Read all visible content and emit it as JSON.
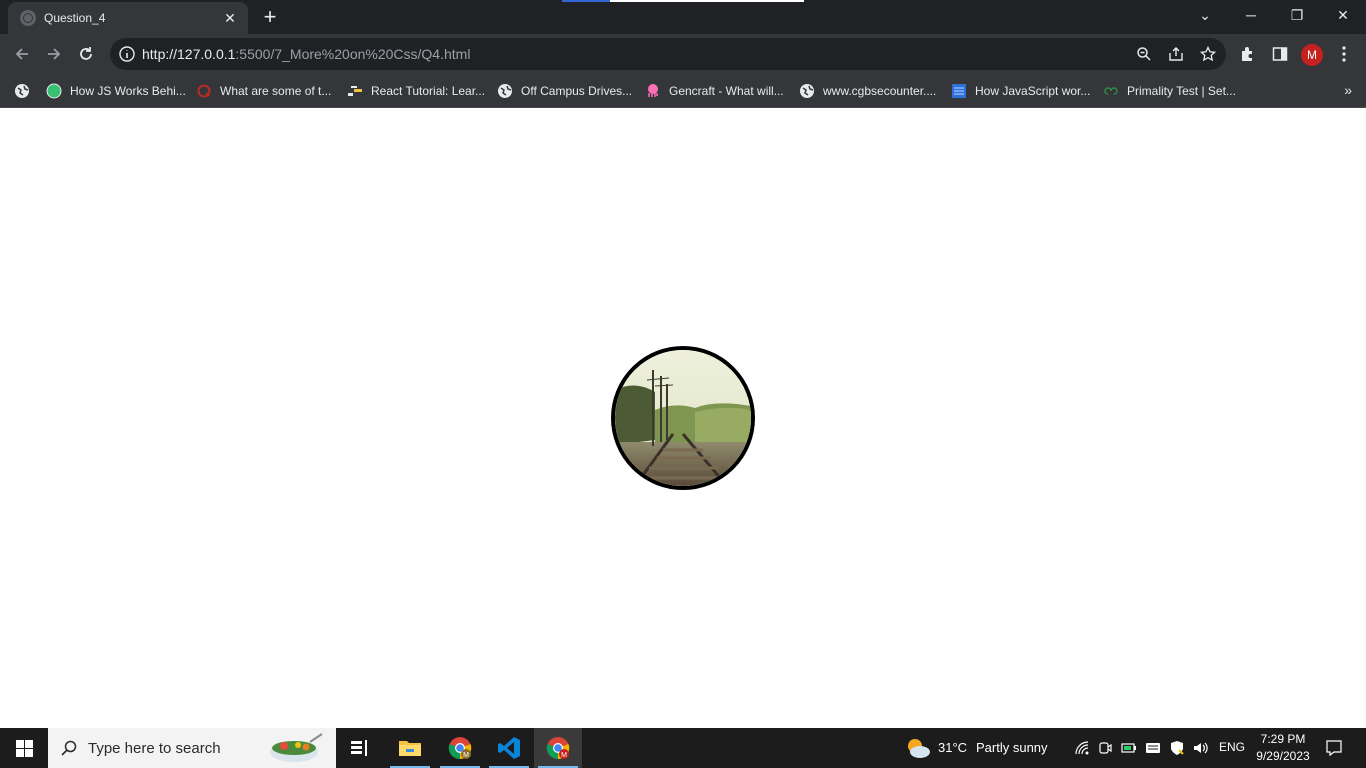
{
  "browser": {
    "tab_title": "Question_4",
    "tab_close": "✕",
    "new_tab": "+",
    "window_controls": {
      "tab_search": "⌄",
      "minimize": "─",
      "restore": "❐",
      "close": "✕"
    },
    "url_host": "http://127.0.0.1",
    "url_path": ":5500/7_More%20on%20Css/Q4.html",
    "profile_initial": "M",
    "bookmarks": [
      {
        "label": "How JS Works Behi...",
        "icon": "green-circle-icon"
      },
      {
        "label": "What are some of t...",
        "icon": "quora-icon"
      },
      {
        "label": "React Tutorial: Lear...",
        "icon": "bars-icon"
      },
      {
        "label": "Off Campus Drives...",
        "icon": "globe-icon"
      },
      {
        "label": "Gencraft - What will...",
        "icon": "octopus-icon"
      },
      {
        "label": "www.cgbsecounter....",
        "icon": "globe-icon"
      },
      {
        "label": "How JavaScript wor...",
        "icon": "doc-icon"
      },
      {
        "label": "Primality Test | Set...",
        "icon": "gfg-icon"
      }
    ],
    "bookmarks_more": "»"
  },
  "taskbar": {
    "search_placeholder": "Type here to search",
    "weather_temp": "31°C",
    "weather_desc": "Partly sunny",
    "language": "ENG",
    "time": "7:29 PM",
    "date": "9/29/2023"
  },
  "colors": {
    "chrome_dark": "#202124",
    "chrome_toolbar": "#35363a",
    "profile": "#c5221f",
    "taskbar": "#1c1c1c"
  }
}
